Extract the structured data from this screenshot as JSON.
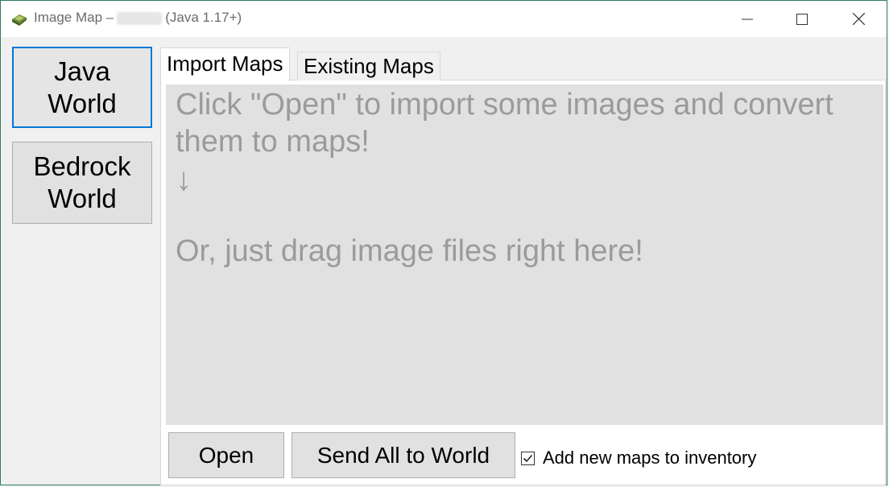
{
  "window": {
    "title_prefix": "Image Map –",
    "title_suffix": "(Java 1.17+)",
    "controls": {
      "minimize": "minimize-icon",
      "maximize": "maximize-icon",
      "close": "close-icon"
    }
  },
  "sidebar": {
    "items": [
      {
        "label": "Java\nWorld",
        "selected": true
      },
      {
        "label": "Bedrock\nWorld",
        "selected": false
      }
    ]
  },
  "tabs": [
    {
      "label": "Import Maps",
      "active": true
    },
    {
      "label": "Existing Maps",
      "active": false
    }
  ],
  "drop_area": {
    "line1": "Click \"Open\" to import some images and convert them to maps!",
    "arrow": "↓",
    "line2": "Or, just drag image files right here!"
  },
  "actions": {
    "open_label": "Open",
    "send_label": "Send All to World",
    "checkbox_label": "Add new maps to inventory",
    "checkbox_checked": true
  },
  "colors": {
    "accent": "#0078d7",
    "window_border": "#2f7f5c",
    "drop_bg": "#e1e1e1",
    "drop_text": "#9b9b9b"
  }
}
